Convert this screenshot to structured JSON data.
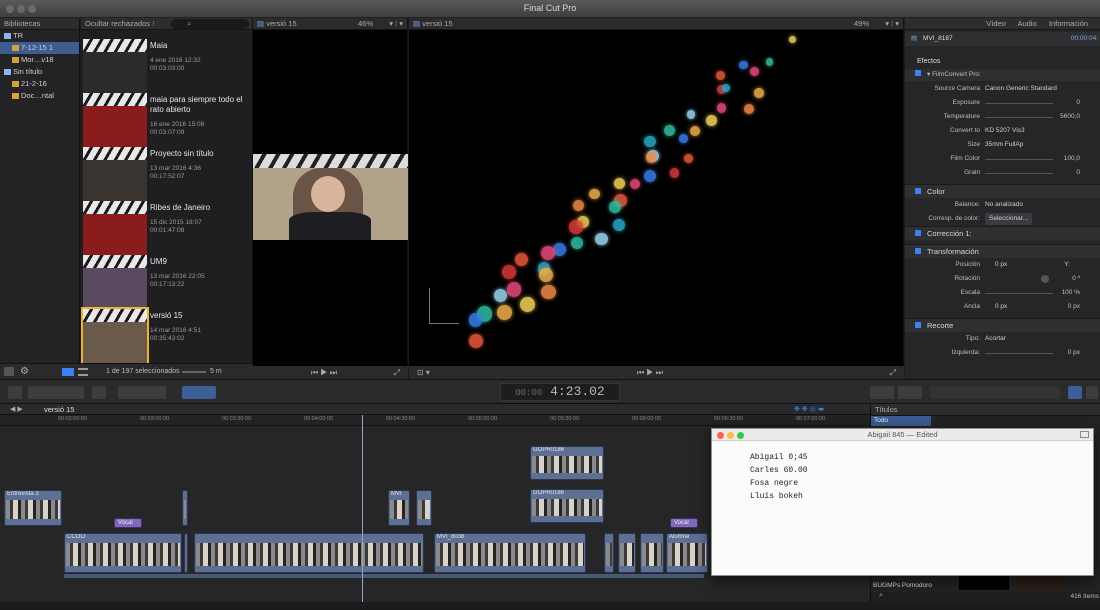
{
  "window": {
    "title": "Final Cut Pro"
  },
  "library": {
    "header_label": "Bibliotecas",
    "items": [
      {
        "label": "TR",
        "level": 0
      },
      {
        "label": "7-12-15 1",
        "level": 1,
        "selected": true
      },
      {
        "label": "Mor…v18",
        "level": 1
      },
      {
        "label": "Sin título",
        "level": 0
      },
      {
        "label": "21-2-16",
        "level": 1
      },
      {
        "label": "Doc…ntal",
        "level": 1
      }
    ]
  },
  "browser": {
    "filter_label": "Ocultar rechazados ⁝",
    "clips": [
      {
        "name": "Maia",
        "date": "4 ene 2016 12:32",
        "duration": "00:03:03:00"
      },
      {
        "name": "maia para siempre todo el rato abierto",
        "date": "16 ene 2016 15:08",
        "duration": "00:03:07:09"
      },
      {
        "name": "Proyecto sin título",
        "date": "13 mar 2016 4:36",
        "duration": "00:17:52:07"
      },
      {
        "name": "Ribes de Janeiro",
        "date": "15 dic 2015 18:07",
        "duration": "00:01:47:08"
      },
      {
        "name": "UM9",
        "date": "13 mar 2016 22:05",
        "duration": "00:17:13:22"
      },
      {
        "name": "versió 15",
        "date": "14 mar 2016 4:51",
        "duration": "00:35:43:02"
      }
    ],
    "selection_status": "1 de 197 seleccionados",
    "zoom_label": "5 m"
  },
  "viewer_left": {
    "title": "versió 15",
    "zoom": "46%"
  },
  "viewer_right": {
    "title": "versió 15",
    "zoom": "49%"
  },
  "inspector": {
    "tabs": [
      "Vídeo",
      "Audio",
      "Información"
    ],
    "clip_name": "MVI_8187",
    "clip_tc": "00:00:04:",
    "effects_title": "Efectos",
    "filmconvert": {
      "title": "FilmConvert Pro:",
      "source_camera_label": "Source Camera",
      "source_camera_value": "Canon Generic Standard",
      "exposure_label": "Exposure",
      "exposure_value": "0",
      "temperature_label": "Temperature",
      "temperature_value": "5600,0",
      "convert_to_label": "Convert to",
      "convert_to_value": "KD 5207 Vis3",
      "size_label": "Size",
      "size_value": "35mm FullAp",
      "film_color_label": "Film Color",
      "film_color_value": "100,0",
      "grain_label": "Grain",
      "grain_value": "0"
    },
    "color": {
      "title": "Color",
      "balance_label": "Balance:",
      "balance_value": "No analizado",
      "match_label": "Corresp. de color:",
      "match_button": "Seleccionar..."
    },
    "correction_label": "Corrección 1:",
    "transform": {
      "title": "Transformación",
      "position_label": "Posición",
      "position_x": "0 px",
      "position_y": "Y:",
      "rotation_label": "Rotación",
      "rotation_value": "0 º",
      "scale_label": "Escala",
      "scale_value": "100 %",
      "anchor_label": "Ancla",
      "anchor_x": "0 px",
      "anchor_y": "0 px"
    },
    "crop": {
      "title": "Recorte",
      "type_label": "Tipo:",
      "type_value": "Acortar",
      "left_label": "Izquierda:",
      "left_value": "0 px"
    }
  },
  "toolbar": {
    "timecode": "4:23.02",
    "timecode_prefix": "00:00"
  },
  "timeline": {
    "project_name": "versió 15",
    "ruler_ticks": [
      "00:02:00:00",
      "00:03:00:00",
      "00:03:30:00",
      "00:04:00:00",
      "00:04:30:00",
      "00:05:00:00",
      "00:05:30:00",
      "00:06:00:00",
      "00:06:30:00",
      "00:07:00:00"
    ],
    "clip_labels": {
      "connected_a": "GOPR0186",
      "connected_b": "GOPR0186",
      "left_clip": "Entrevista 3",
      "main_a": "CCOO",
      "main_b": "MVI_8038",
      "main_c": "Alumne",
      "voice_a": "Vocal",
      "voice_b": "Vocal",
      "mvi": "MVI"
    }
  },
  "title_browser": {
    "header": "Títulos",
    "all_label": "Todo",
    "item": "BUGMPs Pomodoro",
    "count": "416 Items"
  },
  "note_window": {
    "title": "Abigail 845 — Edited",
    "lines": [
      "Abigail 0;45",
      "Carles 60.00",
      "Fosa negre",
      "Lluís bokeh"
    ]
  },
  "colors": {
    "selection": "#3c5c92",
    "clip_blue": "#5e6f94",
    "clip_purple": "#7e6ab6",
    "accent": "#3b82f6"
  }
}
